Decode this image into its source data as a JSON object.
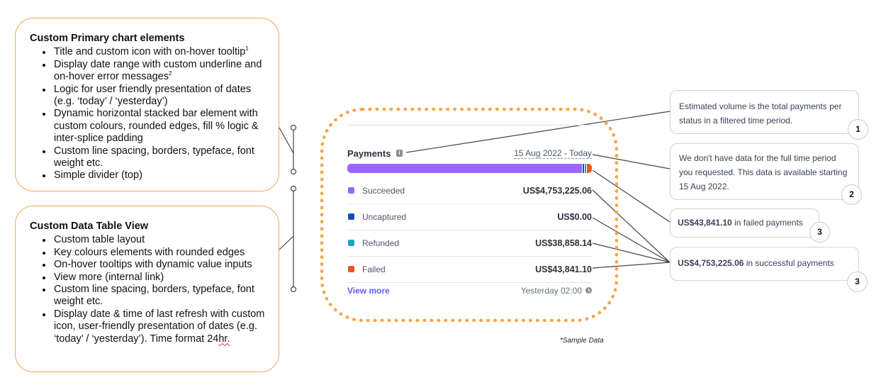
{
  "primary_box": {
    "heading": "Custom Primary chart elements",
    "items": [
      "Title and custom icon with on-hover tooltip",
      "Display date range with custom underline and on-hover error messages",
      "Logic for user friendly presentation of dates (e.g. ‘today’ / ‘yesterday’)",
      "Dynamic horizontal stacked bar element with custom colours, rounded edges, fill % logic & inter-splice padding",
      "Custom line spacing, borders, typeface, font weight etc.",
      "Simple divider (top)"
    ],
    "item_sup_1": "1",
    "item_sup_2": "2"
  },
  "table_box": {
    "heading": "Custom Data Table View",
    "items": [
      "Custom table layout",
      "Key colours elements with rounded edges",
      "On-hover tooltips with dynamic value inputs",
      "View more (internal link)",
      "Custom line spacing, borders, typeface, font weight etc.",
      "Display date & time of last refresh with custom icon, user-friendly presentation of dates (e.g. ‘today’ / ‘yesterday’). Time format 24",
      "hr."
    ]
  },
  "widget": {
    "title": "Payments",
    "info_icon_glyph": "i",
    "date_range": "15 Aug 2022 - Today",
    "rows": [
      {
        "label": "Succeeded",
        "value": "US$4,753,225.06",
        "color": "#9966ff"
      },
      {
        "label": "Uncaptured",
        "value": "US$0.00",
        "color": "#0f4fb8"
      },
      {
        "label": "Refunded",
        "value": "US$38,858.14",
        "color": "#1ba3c4"
      },
      {
        "label": "Failed",
        "value": "US$43,841.10",
        "color": "#e5571d"
      }
    ],
    "view_more": "View more",
    "last_refresh": "Yesterday 02:00"
  },
  "sample_note": "*Sample Data",
  "tooltips": {
    "volume": "Estimated volume is the total payments per status in a filtered time period.",
    "no_data": "We don't have data for the full time period you requested. This data is available starting 15 Aug 2022.",
    "failed_amount": "US$43,841.10",
    "failed_suffix": " in failed payments",
    "success_amount": "US$4,753,225.06",
    "success_suffix": " in successful payments"
  },
  "badges": [
    "1",
    "2",
    "3",
    "3"
  ],
  "colors": {
    "accent_orange": "#f6a54a",
    "link": "#635bff"
  }
}
